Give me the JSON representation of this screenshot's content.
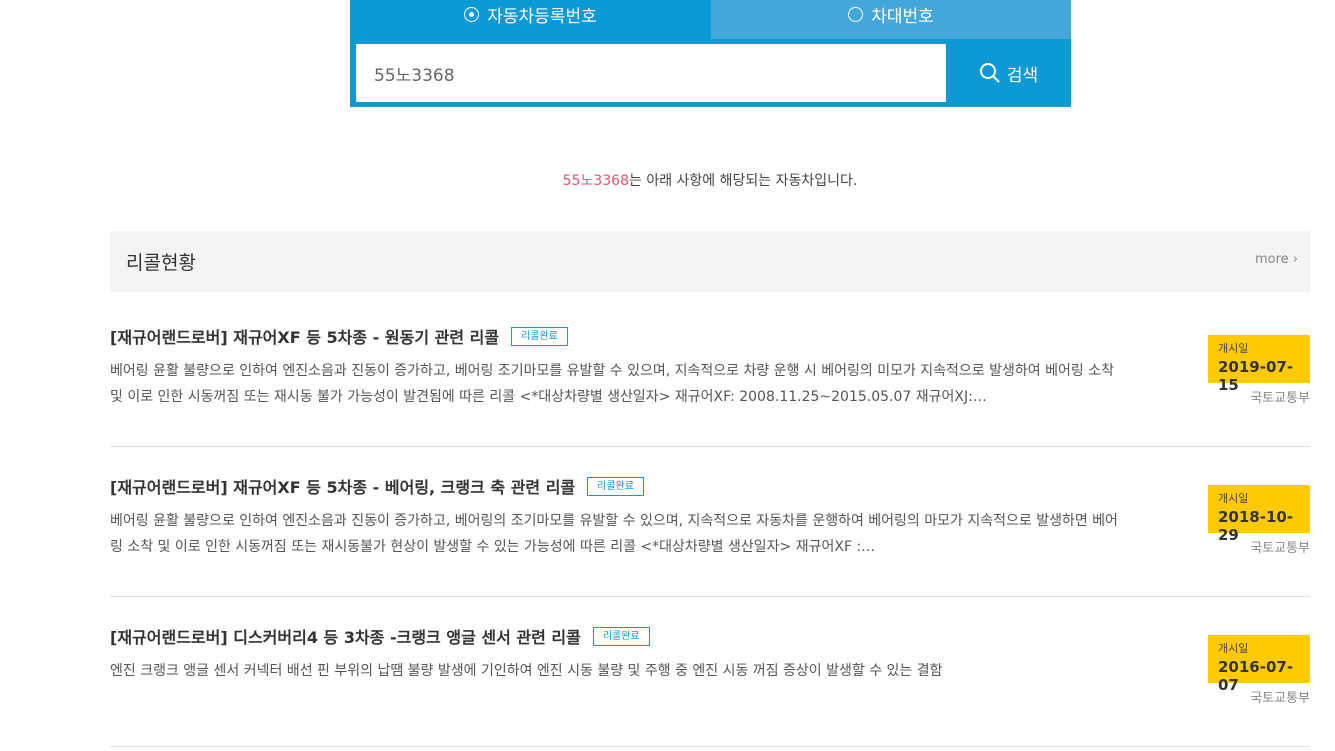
{
  "search": {
    "tab_registration": "자동차등록번호",
    "tab_vin": "차대번호",
    "input_value": "55노3368",
    "button_label": "검색"
  },
  "result": {
    "plate": "55노3368",
    "message": "는 아래 사항에 해당되는 자동차입니다."
  },
  "section": {
    "title": "리콜현황",
    "more": "more ›"
  },
  "recalls": [
    {
      "title": "[재규어랜드로버] 재규어XF 등 5차종 - 원동기 관련 리콜",
      "badge": "리콜완료",
      "desc": "베어링 윤활 불량으로 인하여 엔진소음과 진동이 증가하고, 베어링 조기마모를 유발할 수 있으며, 지속적으로 차량 운행 시 베어링의 미모가 지속적으로 발생하여 베어링 소착 및 이로 인한 시동꺼짐 또는 재시동 불가 가능성이 발견됨에 따른 리콜 <*대상차량별 생산일자> 재규어XF: 2008.11.25~2015.05.07 재규어XJ:…",
      "date_label": "개시일",
      "date": "2019-07-15",
      "agency": "국토교통부"
    },
    {
      "title": "[재규어랜드로버] 재규어XF 등 5차종 - 베어링, 크랭크 축 관련 리콜",
      "badge": "리콜완료",
      "desc": "베어링 윤활 불량으로 인하여 엔진소음과 진동이 증가하고, 베어링의 조기마모를 유발할 수 있으며, 지속적으로 자동차를 운행하여 베어링의 마모가 지속적으로 발생하면 베어링 소착 및 이로 인한 시동꺼짐 또는 재시동불가 현상이 발생할 수 있는 가능성에 따른 리콜 <*대상차량별 생산일자> 재규어XF :…",
      "date_label": "개시일",
      "date": "2018-10-29",
      "agency": "국토교통부"
    },
    {
      "title": "[재규어랜드로버] 디스커버리4 등 3차종 -크랭크 앵글 센서 관련 리콜",
      "badge": "리콜완료",
      "desc": "엔진 크랭크 앵글 센서 커넥터 배선 핀 부위의 납땜 불량 발생에 기인하여 엔진 시동 불량 및 주행 중 엔진 시동 꺼짐 증상이 발생할 수 있는 결함",
      "date_label": "개시일",
      "date": "2016-07-07",
      "agency": "국토교통부"
    }
  ],
  "colors": {
    "primary": "#0b9ad6",
    "tab_inactive": "#44a7d9",
    "highlight": "#e0566f",
    "date_bg": "#ffcb00"
  }
}
